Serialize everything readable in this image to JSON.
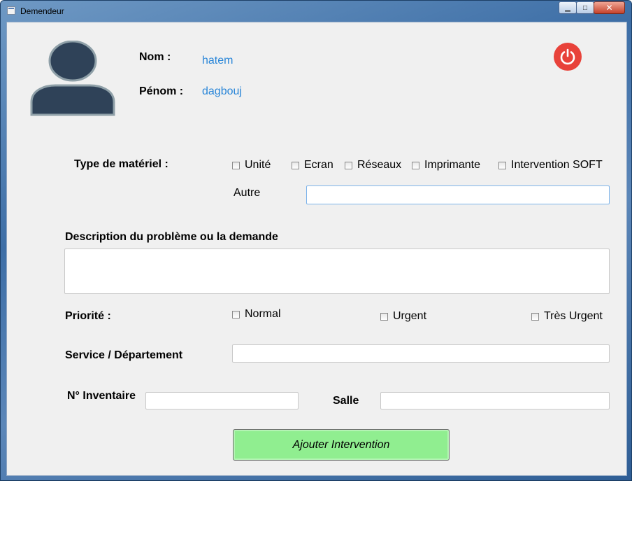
{
  "window": {
    "title": "Demendeur",
    "minimize_symbol": "▁",
    "maximize_symbol": "□",
    "close_symbol": "✕"
  },
  "user": {
    "nom_label": "Nom :",
    "nom_value": "hatem",
    "prenom_label": "Pénom :",
    "prenom_value": "dagbouj",
    "avatar_icon": "user-silhouette-icon",
    "power_icon": "power-icon"
  },
  "materiel": {
    "label": "Type de matériel :",
    "options": [
      {
        "label": "Unité",
        "checked": false
      },
      {
        "label": "Ecran",
        "checked": false
      },
      {
        "label": "Réseaux",
        "checked": false
      },
      {
        "label": "Imprimante",
        "checked": false
      },
      {
        "label": "Intervention SOFT",
        "checked": false
      }
    ],
    "autre_label": "Autre",
    "autre_value": ""
  },
  "description": {
    "label": "Description du problème ou la demande",
    "value": ""
  },
  "priorite": {
    "label": "Priorité :",
    "options": [
      {
        "label": "Normal",
        "checked": false
      },
      {
        "label": "Urgent",
        "checked": false
      },
      {
        "label": "Très Urgent",
        "checked": false
      }
    ]
  },
  "service": {
    "label": "Service / Département",
    "value": ""
  },
  "inventaire": {
    "label": "N° Inventaire",
    "value": ""
  },
  "salle": {
    "label": "Salle",
    "value": ""
  },
  "submit_label": "Ajouter Intervention",
  "colors": {
    "accent_blue": "#2a86d8",
    "power_red": "#e8423a",
    "submit_green": "#90ee90",
    "avatar_fill": "#2f4258"
  }
}
